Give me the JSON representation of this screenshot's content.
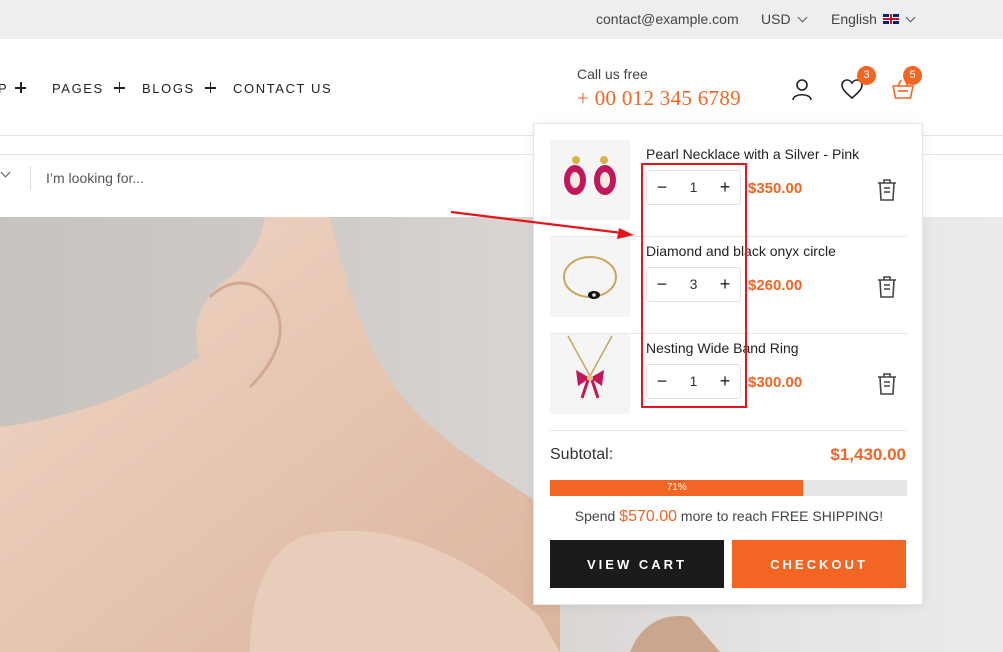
{
  "topbar": {
    "email": "contact@example.com",
    "currency": "USD",
    "language": "English"
  },
  "nav": {
    "items": [
      {
        "label": "P"
      },
      {
        "label": "PAGES"
      },
      {
        "label": "BLOGS"
      },
      {
        "label": "CONTACT US"
      }
    ]
  },
  "header": {
    "call_label": "Call us free",
    "phone": "+ 00 012 345 6789",
    "wishlist_count": "3",
    "cart_count": "5"
  },
  "search": {
    "placeholder": "I’m looking for..."
  },
  "cart": {
    "items": [
      {
        "name": "Pearl Necklace with a Silver - Pink",
        "qty": "1",
        "price": "$350.00"
      },
      {
        "name": "Diamond and black onyx circle",
        "qty": "3",
        "price": "$260.00"
      },
      {
        "name": "Nesting Wide Band Ring",
        "qty": "1",
        "price": "$300.00"
      }
    ],
    "qty_minus": "−",
    "qty_plus": "+",
    "subtotal_label": "Subtotal:",
    "subtotal": "$1,430.00",
    "progress_label": "71%",
    "progress_fraction": 0.71,
    "shipping_prefix": "Spend",
    "shipping_amount": "$570.00",
    "shipping_suffix": "more to reach FREE SHIPPING!",
    "view_cart": "VIEW CART",
    "checkout": "CHECKOUT"
  },
  "colors": {
    "accent": "#f26522",
    "dark_button": "#1b1b1b",
    "annotation": "#e8141c"
  }
}
